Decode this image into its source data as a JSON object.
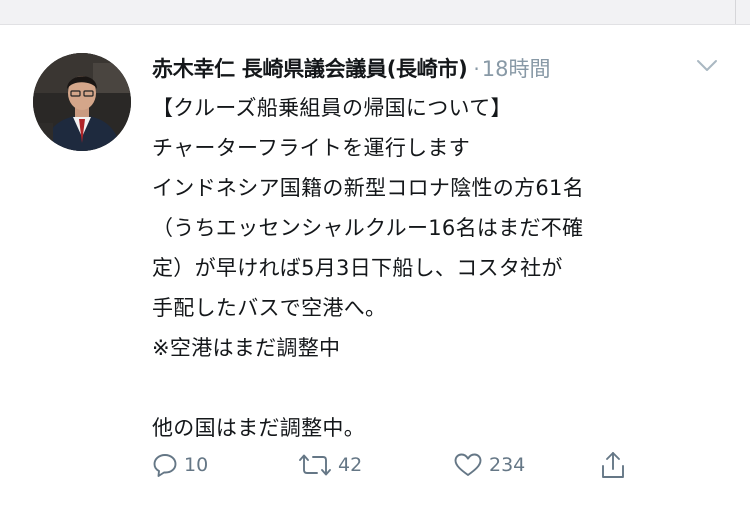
{
  "tweet": {
    "author": "赤木幸仁 長崎県議会議員(長崎市)",
    "separator": "·",
    "time": "18時間",
    "lines": [
      "【クルーズ船乗組員の帰国について】",
      "チャーターフライトを運行します",
      "インドネシア国籍の新型コロナ陰性の方61名",
      "（うちエッセンシャルクルー16名はまだ不確",
      "定）が早ければ5月3日下船し、コスタ社が",
      "手配したバスで空港へ。",
      "※空港はまだ調整中",
      "",
      "他の国はまだ調整中。"
    ],
    "actions": {
      "reply": {
        "icon": "reply-icon",
        "count": "10"
      },
      "retweet": {
        "icon": "retweet-icon",
        "count": "42"
      },
      "like": {
        "icon": "heart-icon",
        "count": "234"
      },
      "share": {
        "icon": "share-icon"
      }
    }
  },
  "colors": {
    "text": "#14171a",
    "muted": "#8899a6",
    "action": "#657786",
    "background": "#ffffff",
    "top_band": "#f2f2f4"
  }
}
